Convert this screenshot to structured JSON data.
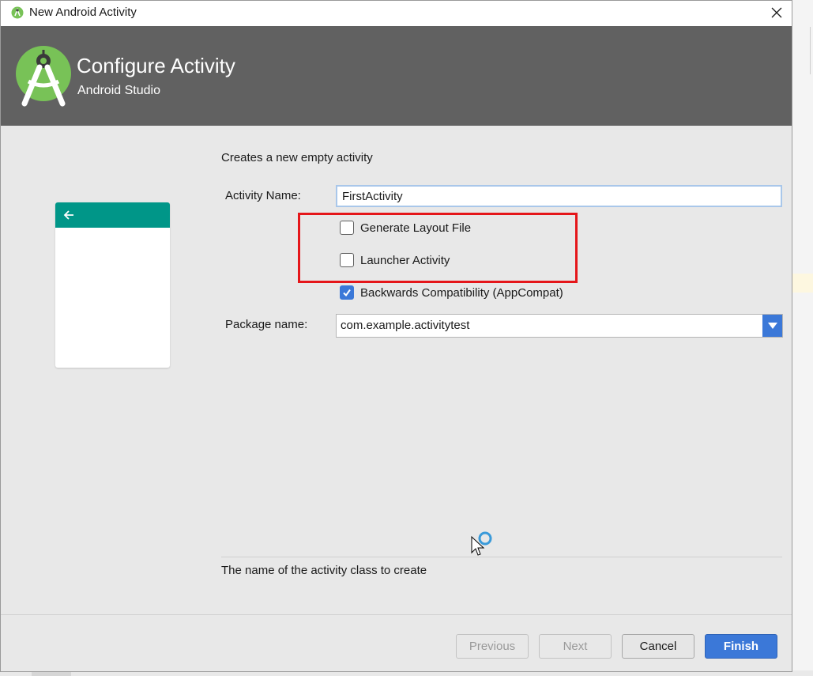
{
  "window": {
    "title": "New Android Activity",
    "close_glyph": "✕"
  },
  "header": {
    "title": "Configure Activity",
    "subtitle": "Android Studio",
    "logo_icon": "android-studio-logo-icon"
  },
  "preview": {
    "toolbar_color": "#009688",
    "back_icon": "arrow-left-icon"
  },
  "form": {
    "description": "Creates a new empty activity",
    "activity_name_label": "Activity Name:",
    "activity_name_value": "FirstActivity",
    "checkboxes": [
      {
        "label": "Generate Layout File",
        "checked": false
      },
      {
        "label": "Launcher Activity",
        "checked": false
      },
      {
        "label": "Backwards Compatibility (AppCompat)",
        "checked": true
      }
    ],
    "package_name_label": "Package name:",
    "package_name_value": "com.example.activitytest"
  },
  "hint": "The name of the activity class to create",
  "buttons": {
    "previous": "Previous",
    "next": "Next",
    "cancel": "Cancel",
    "finish": "Finish"
  },
  "colors": {
    "header_bg": "#616161",
    "accent": "#3b78d8",
    "highlight_box": "#e5161a"
  }
}
